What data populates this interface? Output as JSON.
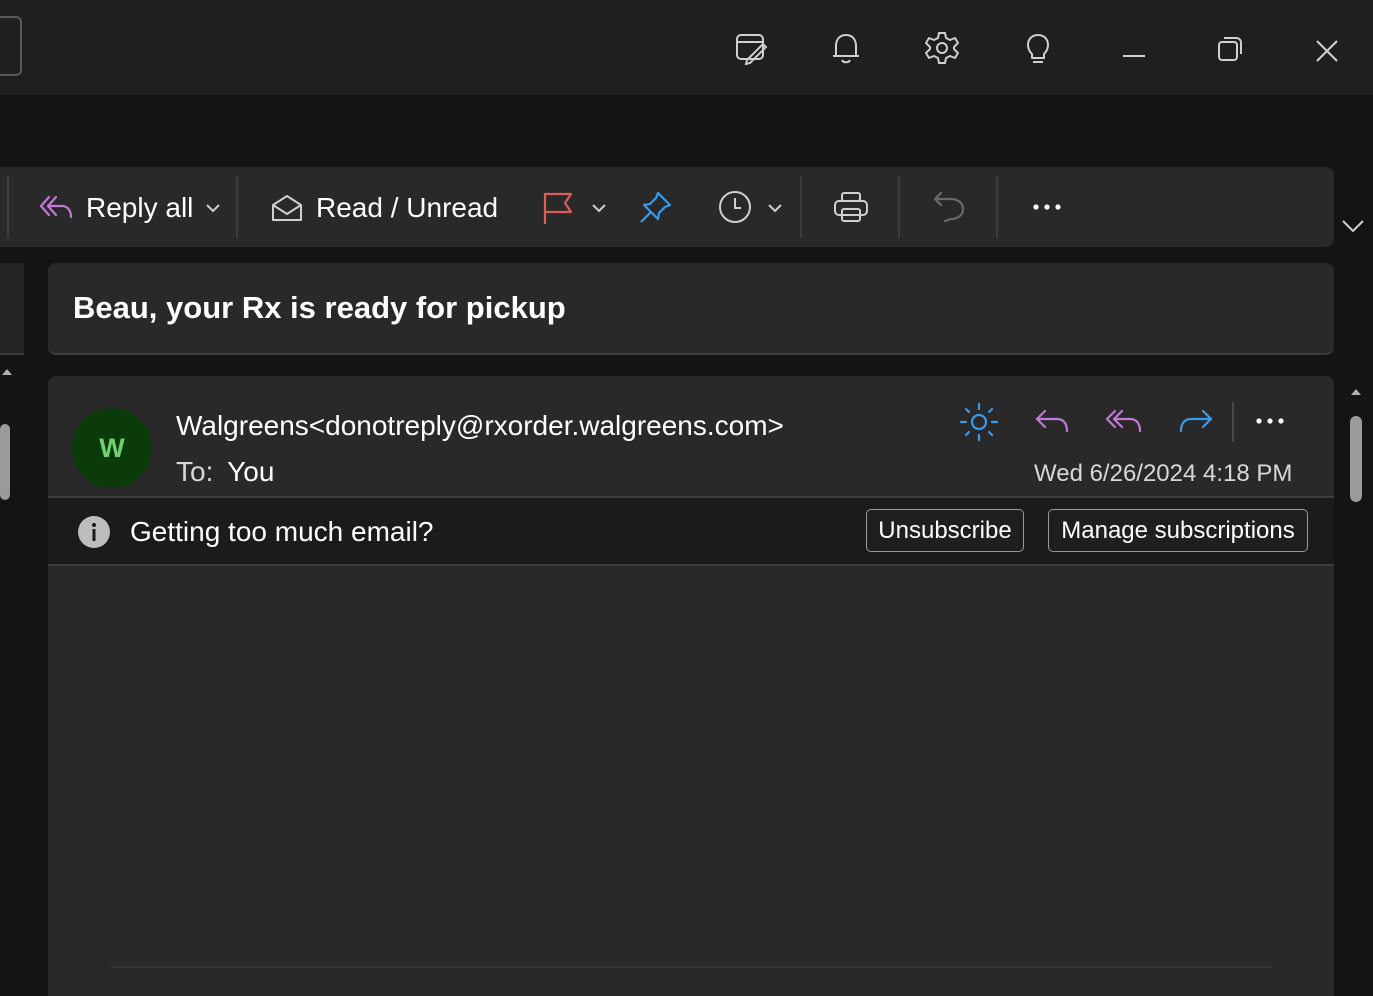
{
  "titlebar": {
    "icons": [
      "task-icon",
      "bell-icon",
      "gear-icon",
      "lightbulb-icon",
      "minimize-icon",
      "restore-icon",
      "close-icon"
    ]
  },
  "ribbon": {
    "reply_all_label": "Reply all",
    "read_unread_label": "Read / Unread",
    "icons": [
      "reply-all-icon",
      "envelope-open-icon",
      "flag-icon",
      "pin-icon",
      "clock-icon",
      "print-icon",
      "undo-icon",
      "more-icon",
      "expand-chevron-icon"
    ]
  },
  "message": {
    "subject": "Beau, your Rx is ready for pickup",
    "avatar_initial": "W",
    "sender": "Walgreens<donotreply@rxorder.walgreens.com>",
    "to_label": "To:",
    "to_value": "You",
    "date": "Wed 6/26/2024 4:18 PM",
    "info_text": "Getting too much email?",
    "unsubscribe_label": "Unsubscribe",
    "manage_label": "Manage subscriptions"
  },
  "colors": {
    "accent_purple": "#c17ad6",
    "accent_blue": "#3a9be8",
    "flag_red": "#e05a5a",
    "avatar_bg": "#0b3a0b",
    "avatar_text": "#6fd26f"
  }
}
